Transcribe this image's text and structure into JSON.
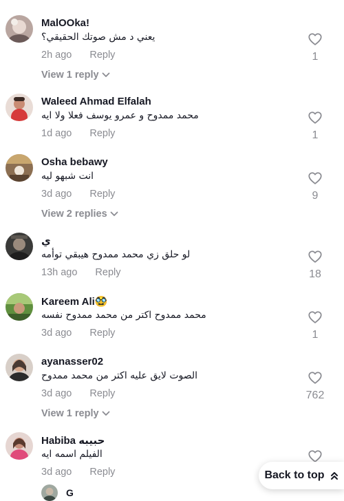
{
  "comments": [
    {
      "username": "MalOOka!",
      "text": "يعني د مش صوتك الحقيقي؟",
      "time": "2h ago",
      "reply_label": "Reply",
      "likes": "1",
      "view_replies": "View 1 reply"
    },
    {
      "username": "Waleed Ahmad Elfalah",
      "text": "محمد ممدوح و عمرو يوسف فعلا ولا ايه",
      "time": "1d ago",
      "reply_label": "Reply",
      "likes": "1"
    },
    {
      "username": "Osha bebawy",
      "text": "انت شبهو ليه",
      "time": "3d ago",
      "reply_label": "Reply",
      "likes": "9",
      "view_replies": "View 2 replies"
    },
    {
      "username": "ي",
      "text": "لو حلق زي محمد ممدوح هيبقي توأمه",
      "time": "13h ago",
      "reply_label": "Reply",
      "likes": "18"
    },
    {
      "username": "Kareem Ali🥸",
      "text": "محمد ممدوح اكتر من محمد ممدوح نفسه",
      "time": "3d ago",
      "reply_label": "Reply",
      "likes": "1"
    },
    {
      "username": "ayanasser02",
      "text": "الصوت لايق عليه اكتر من محمد ممدوح",
      "time": "3d ago",
      "reply_label": "Reply",
      "likes": "762",
      "view_replies": "View 1 reply"
    },
    {
      "username": "Habiba حبيبه",
      "text": "الفيلم اسمه ايه",
      "time": "3d ago",
      "reply_label": "Reply",
      "likes": ""
    }
  ],
  "partial_reply": {
    "username": "G"
  },
  "back_to_top": {
    "label": "Back to top",
    "icon": "double-chevron-up-icon"
  },
  "icons": {
    "like": "heart-outline-icon",
    "expand": "chevron-down-icon"
  },
  "colors": {
    "text": "#161823",
    "muted": "#8a8b91",
    "background": "#ffffff"
  }
}
